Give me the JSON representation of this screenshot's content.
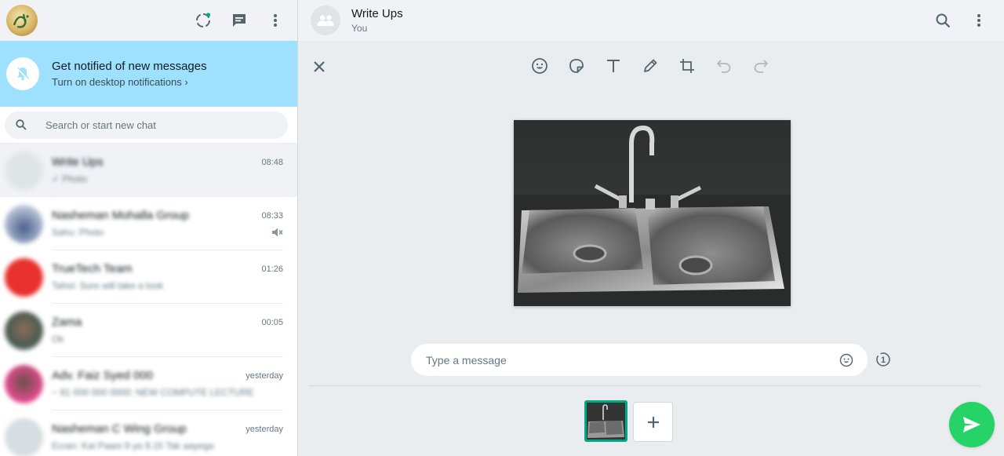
{
  "sidebar": {
    "notification": {
      "title": "Get notified of new messages",
      "subtitle": "Turn on desktop notifications ›"
    },
    "search": {
      "placeholder": "Search or start new chat"
    },
    "chats": [
      {
        "name": "Write Ups",
        "time": "08:48",
        "preview": "✓ Photo",
        "avatar_color": "#dfe5e7"
      },
      {
        "name": "Nasheman Mohalla Group",
        "time": "08:33",
        "preview": "Sahu: Photo",
        "avatar_color": "#7a8ba8",
        "muted": true
      },
      {
        "name": "TrueTech Team",
        "time": "01:26",
        "preview": "Tahoi: Sure will take a look",
        "avatar_color": "#e8312f"
      },
      {
        "name": "Zama",
        "time": "00:05",
        "preview": "Ok",
        "avatar_color": "#5a6a5e"
      },
      {
        "name": "Adv. Faiz Syed 000",
        "time": "yesterday",
        "preview": "~ 91 000 000 0000: NEW COMPUTE LECTURE",
        "avatar_color": "#e04a8c"
      },
      {
        "name": "Nasheman C Wing Group",
        "time": "yesterday",
        "preview": "Ecran: Kal Paani 9 ya 9.15 Tak aayega",
        "avatar_color": "#d7dde0"
      }
    ]
  },
  "chat_header": {
    "name": "Write Ups",
    "subtitle": "You"
  },
  "composer": {
    "caption_placeholder": "Type a message",
    "view_once_label": "1"
  },
  "colors": {
    "accent": "#00a884",
    "send": "#25d366",
    "notification_bg": "#9de1fe"
  }
}
